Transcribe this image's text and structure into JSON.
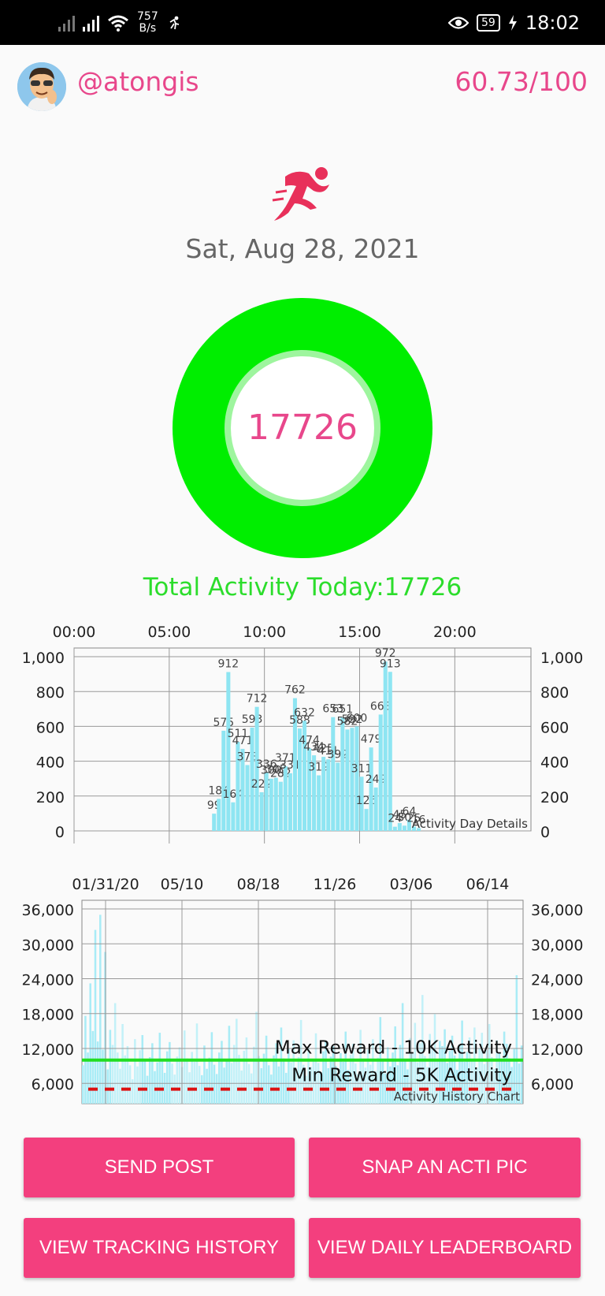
{
  "status_bar": {
    "net_speed_value": "757",
    "net_speed_unit": "B/s",
    "battery": "59",
    "time": "18:02"
  },
  "profile": {
    "username": "@atongis",
    "score": "60.73/100"
  },
  "date": "Sat, Aug 28, 2021",
  "ring": {
    "value": "17726",
    "color": "#00ee00"
  },
  "total_activity": "Total Activity Today:17726",
  "chart_data": [
    {
      "type": "bar",
      "legend_label": "Activity Day Details",
      "x_ticks": [
        "00:00",
        "05:00",
        "10:00",
        "15:00",
        "20:00"
      ],
      "y_ticks": [
        "0",
        "200",
        "400",
        "600",
        "800",
        "1,000"
      ],
      "ylim": [
        0,
        1050
      ],
      "bars": [
        {
          "t": "07:15",
          "v": 99
        },
        {
          "t": "07:30",
          "v": 184
        },
        {
          "t": "07:45",
          "v": 575
        },
        {
          "t": "08:00",
          "v": 912
        },
        {
          "t": "08:15",
          "v": 164
        },
        {
          "t": "08:30",
          "v": 511
        },
        {
          "t": "08:45",
          "v": 471
        },
        {
          "t": "09:00",
          "v": 378
        },
        {
          "t": "09:15",
          "v": 593
        },
        {
          "t": "09:30",
          "v": 712
        },
        {
          "t": "09:45",
          "v": 222
        },
        {
          "t": "10:00",
          "v": 336
        },
        {
          "t": "10:15",
          "v": 300
        },
        {
          "t": "10:30",
          "v": 305
        },
        {
          "t": "10:45",
          "v": 282
        },
        {
          "t": "11:00",
          "v": 371
        },
        {
          "t": "11:15",
          "v": 331
        },
        {
          "t": "11:30",
          "v": 762
        },
        {
          "t": "11:45",
          "v": 588
        },
        {
          "t": "12:00",
          "v": 632
        },
        {
          "t": "12:15",
          "v": 474
        },
        {
          "t": "12:30",
          "v": 434
        },
        {
          "t": "12:45",
          "v": 319
        },
        {
          "t": "13:00",
          "v": 425
        },
        {
          "t": "13:15",
          "v": 411
        },
        {
          "t": "13:30",
          "v": 653
        },
        {
          "t": "13:45",
          "v": 392
        },
        {
          "t": "14:00",
          "v": 651
        },
        {
          "t": "14:15",
          "v": 582
        },
        {
          "t": "14:30",
          "v": 592
        },
        {
          "t": "14:45",
          "v": 600
        },
        {
          "t": "15:00",
          "v": 311
        },
        {
          "t": "15:15",
          "v": 126
        },
        {
          "t": "15:30",
          "v": 479
        },
        {
          "t": "15:45",
          "v": 249
        },
        {
          "t": "16:00",
          "v": 668
        },
        {
          "t": "16:15",
          "v": 972
        },
        {
          "t": "16:30",
          "v": 913
        },
        {
          "t": "16:45",
          "v": 24
        },
        {
          "t": "17:00",
          "v": 45
        },
        {
          "t": "17:15",
          "v": 30
        },
        {
          "t": "17:30",
          "v": 64
        },
        {
          "t": "17:45",
          "v": 25
        },
        {
          "t": "18:00",
          "v": 16
        }
      ]
    },
    {
      "type": "bar",
      "legend_label": "Activity History Chart",
      "x_ticks": [
        "01/31/20",
        "05/10",
        "08/18",
        "11/26",
        "03/06",
        "06/14"
      ],
      "y_ticks": [
        "6,000",
        "12,000",
        "18,000",
        "24,000",
        "30,000",
        "36,000"
      ],
      "ylim": [
        2500,
        37500
      ],
      "max_reward": {
        "label": "Max Reward - 10K Activity",
        "value": 10000,
        "color": "#22dd22"
      },
      "min_reward": {
        "label": "Min Reward - 5K Activity",
        "value": 5000,
        "color": "#dd1111"
      },
      "values": [
        9100,
        17600,
        11300,
        23200,
        15000,
        32400,
        13200,
        35000,
        11800,
        28600,
        8400,
        15200,
        12600,
        19800,
        11300,
        8500,
        16200,
        10800,
        12400,
        9100,
        6700,
        13600,
        8900,
        11700,
        14300,
        9800,
        7300,
        10500,
        12900,
        8100,
        9600,
        14700,
        10200,
        7800,
        11500,
        13100,
        9400,
        7500,
        10600,
        12200,
        8800,
        15100,
        10300,
        7900,
        11400,
        9700,
        16300,
        9000,
        7400,
        12500,
        8500,
        10400,
        14800,
        9200,
        7600,
        11300,
        13300,
        8700,
        10100,
        15900,
        9500,
        12600,
        17100,
        10900,
        8200,
        11600,
        13900,
        9300,
        7700,
        12300,
        18300,
        10700,
        8600,
        11100,
        14200,
        9100,
        7500,
        10800,
        12900,
        8900,
        15600,
        10300,
        7800,
        11900,
        9600,
        13400,
        8400,
        10500,
        16900,
        9200,
        7300,
        12100,
        8800,
        10200,
        14600,
        9500,
        7900,
        11500,
        13200,
        8600,
        10600,
        12400,
        9000,
        7400,
        11200,
        9700,
        14900,
        8300,
        10900,
        12800,
        9400,
        7600,
        15200,
        10100,
        8700,
        11800,
        9200,
        13600,
        8100,
        10400,
        17400,
        9800,
        7700,
        12200,
        8900,
        11300,
        15800,
        9100,
        12600,
        19800,
        10200,
        8400,
        13800,
        11100,
        16400,
        9600,
        12900,
        21200,
        10700,
        8800,
        14500,
        11900,
        17900,
        9900,
        13300,
        12400,
        15300,
        9500,
        11600,
        14200,
        10800,
        8300,
        12700,
        16800,
        9700,
        11400,
        13900,
        10100,
        15600,
        8700,
        12100,
        14700,
        9300,
        11700,
        16200,
        10500,
        8500,
        13400,
        11200,
        9800,
        14900,
        12800,
        10300,
        8800,
        11900,
        24600,
        9400,
        12500
      ]
    }
  ],
  "buttons": {
    "send_post": "SEND POST",
    "snap_pic": "SNAP AN ACTI PIC",
    "tracking_history": "VIEW TRACKING HISTORY",
    "leaderboard": "VIEW DAILY LEADERBOARD"
  }
}
